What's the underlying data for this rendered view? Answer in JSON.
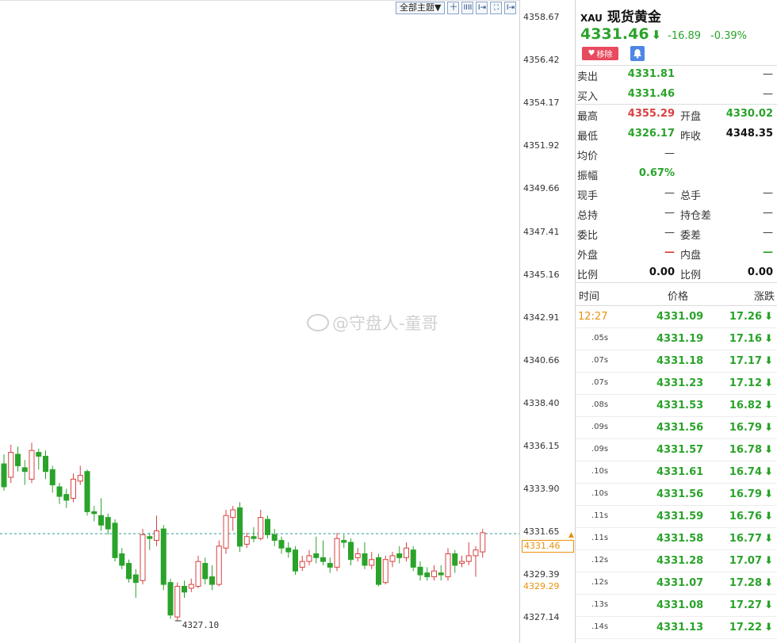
{
  "toolbar": {
    "theme_label": "全部主题▼",
    "buttons": [
      "十",
      "IIII",
      "I⇥",
      "⛶",
      "I⇥"
    ]
  },
  "watermark": "@守盘人-童哥",
  "axis": {
    "ticks": [
      "4358.67",
      "4356.42",
      "4354.17",
      "4351.92",
      "4349.66",
      "4347.41",
      "4345.16",
      "4342.91",
      "4340.66",
      "4338.40",
      "4336.15",
      "4333.90",
      "4331.65",
      "4329.39",
      "4327.14"
    ],
    "current_price_tag": "4331.46",
    "low_price_tag": "4329.29"
  },
  "chart_data": {
    "type": "candlestick",
    "ylim": [
      4327.14,
      4358.67
    ],
    "low_label": "4327.10",
    "reference_line": 4331.65,
    "candles": [
      {
        "o": 4335.3,
        "c": 4334.1,
        "h": 4335.8,
        "l": 4333.9
      },
      {
        "o": 4334.6,
        "c": 4335.9,
        "h": 4336.3,
        "l": 4334.3
      },
      {
        "o": 4335.8,
        "c": 4335.2,
        "h": 4336.2,
        "l": 4334.9
      },
      {
        "o": 4335.1,
        "c": 4334.9,
        "h": 4335.5,
        "l": 4334.2
      },
      {
        "o": 4334.5,
        "c": 4336.0,
        "h": 4336.4,
        "l": 4334.3
      },
      {
        "o": 4335.9,
        "c": 4335.7,
        "h": 4336.1,
        "l": 4335.0
      },
      {
        "o": 4335.7,
        "c": 4334.9,
        "h": 4336.0,
        "l": 4334.5
      },
      {
        "o": 4335.0,
        "c": 4334.2,
        "h": 4335.2,
        "l": 4333.8
      },
      {
        "o": 4334.1,
        "c": 4333.6,
        "h": 4334.3,
        "l": 4333.2
      },
      {
        "o": 4333.7,
        "c": 4333.4,
        "h": 4334.0,
        "l": 4333.0
      },
      {
        "o": 4333.5,
        "c": 4334.5,
        "h": 4334.8,
        "l": 4333.3
      },
      {
        "o": 4334.4,
        "c": 4334.7,
        "h": 4335.2,
        "l": 4334.2
      },
      {
        "o": 4334.9,
        "c": 4332.8,
        "h": 4335.0,
        "l": 4332.6
      },
      {
        "o": 4332.8,
        "c": 4332.7,
        "h": 4333.1,
        "l": 4332.3
      },
      {
        "o": 4332.6,
        "c": 4332.1,
        "h": 4333.5,
        "l": 4331.8
      },
      {
        "o": 4332.5,
        "c": 4331.9,
        "h": 4332.7,
        "l": 4331.6
      },
      {
        "o": 4332.2,
        "c": 4330.4,
        "h": 4332.4,
        "l": 4330.2
      },
      {
        "o": 4330.6,
        "c": 4330.0,
        "h": 4330.9,
        "l": 4329.8
      },
      {
        "o": 4330.1,
        "c": 4329.3,
        "h": 4330.3,
        "l": 4329.1
      },
      {
        "o": 4329.5,
        "c": 4329.1,
        "h": 4329.8,
        "l": 4328.3
      },
      {
        "o": 4329.2,
        "c": 4331.6,
        "h": 4331.9,
        "l": 4329.0
      },
      {
        "o": 4331.5,
        "c": 4331.4,
        "h": 4331.7,
        "l": 4330.8
      },
      {
        "o": 4331.3,
        "c": 4331.8,
        "h": 4332.6,
        "l": 4331.0
      },
      {
        "o": 4331.9,
        "c": 4329.0,
        "h": 4332.1,
        "l": 4328.7
      },
      {
        "o": 4329.1,
        "c": 4327.4,
        "h": 4329.3,
        "l": 4327.2
      },
      {
        "o": 4327.3,
        "c": 4328.9,
        "h": 4329.1,
        "l": 4327.1
      },
      {
        "o": 4328.9,
        "c": 4328.6,
        "h": 4329.2,
        "l": 4328.3
      },
      {
        "o": 4328.8,
        "c": 4329.0,
        "h": 4329.3,
        "l": 4328.6
      },
      {
        "o": 4328.9,
        "c": 4330.2,
        "h": 4330.5,
        "l": 4328.8
      },
      {
        "o": 4330.1,
        "c": 4329.3,
        "h": 4330.4,
        "l": 4329.0
      },
      {
        "o": 4329.4,
        "c": 4329.0,
        "h": 4330.0,
        "l": 4328.7
      },
      {
        "o": 4329.0,
        "c": 4331.0,
        "h": 4331.3,
        "l": 4328.9
      },
      {
        "o": 4330.9,
        "c": 4332.6,
        "h": 4332.9,
        "l": 4330.6
      },
      {
        "o": 4332.5,
        "c": 4332.9,
        "h": 4333.1,
        "l": 4331.8
      },
      {
        "o": 4333.0,
        "c": 4331.0,
        "h": 4333.3,
        "l": 4330.7
      },
      {
        "o": 4331.1,
        "c": 4331.5,
        "h": 4331.7,
        "l": 4330.9
      },
      {
        "o": 4331.5,
        "c": 4331.4,
        "h": 4332.0,
        "l": 4331.2
      },
      {
        "o": 4331.4,
        "c": 4332.5,
        "h": 4332.9,
        "l": 4331.3
      },
      {
        "o": 4332.4,
        "c": 4331.6,
        "h": 4332.6,
        "l": 4331.4
      },
      {
        "o": 4331.6,
        "c": 4331.3,
        "h": 4331.9,
        "l": 4331.0
      },
      {
        "o": 4331.3,
        "c": 4330.9,
        "h": 4331.5,
        "l": 4330.6
      },
      {
        "o": 4330.9,
        "c": 4330.7,
        "h": 4331.2,
        "l": 4330.4
      },
      {
        "o": 4330.8,
        "c": 4329.7,
        "h": 4331.0,
        "l": 4329.5
      },
      {
        "o": 4329.9,
        "c": 4330.2,
        "h": 4330.5,
        "l": 4329.7
      },
      {
        "o": 4330.2,
        "c": 4330.5,
        "h": 4330.8,
        "l": 4330.0
      },
      {
        "o": 4330.6,
        "c": 4330.4,
        "h": 4331.5,
        "l": 4330.1
      },
      {
        "o": 4330.4,
        "c": 4330.2,
        "h": 4331.3,
        "l": 4330.0
      },
      {
        "o": 4330.1,
        "c": 4329.9,
        "h": 4330.4,
        "l": 4329.6
      },
      {
        "o": 4329.9,
        "c": 4331.4,
        "h": 4331.7,
        "l": 4329.7
      },
      {
        "o": 4331.3,
        "c": 4331.2,
        "h": 4331.6,
        "l": 4330.9
      },
      {
        "o": 4331.2,
        "c": 4330.3,
        "h": 4331.4,
        "l": 4330.0
      },
      {
        "o": 4330.4,
        "c": 4330.6,
        "h": 4330.9,
        "l": 4330.2
      },
      {
        "o": 4330.6,
        "c": 4330.0,
        "h": 4331.2,
        "l": 4329.8
      },
      {
        "o": 4330.0,
        "c": 4330.3,
        "h": 4330.7,
        "l": 4329.8
      },
      {
        "o": 4330.4,
        "c": 4329.0,
        "h": 4330.6,
        "l": 4328.9
      },
      {
        "o": 4329.1,
        "c": 4330.3,
        "h": 4330.5,
        "l": 4329.0
      },
      {
        "o": 4330.2,
        "c": 4330.5,
        "h": 4330.7,
        "l": 4329.9
      },
      {
        "o": 4330.6,
        "c": 4330.4,
        "h": 4331.0,
        "l": 4330.1
      },
      {
        "o": 4330.4,
        "c": 4330.9,
        "h": 4331.2,
        "l": 4330.2
      },
      {
        "o": 4330.8,
        "c": 4329.9,
        "h": 4331.0,
        "l": 4329.7
      },
      {
        "o": 4329.9,
        "c": 4329.5,
        "h": 4330.2,
        "l": 4329.2
      },
      {
        "o": 4329.6,
        "c": 4329.4,
        "h": 4329.9,
        "l": 4329.2
      },
      {
        "o": 4329.4,
        "c": 4329.7,
        "h": 4330.0,
        "l": 4329.2
      },
      {
        "o": 4329.6,
        "c": 4329.5,
        "h": 4330.0,
        "l": 4329.2
      },
      {
        "o": 4329.4,
        "c": 4330.6,
        "h": 4330.9,
        "l": 4329.2
      },
      {
        "o": 4330.6,
        "c": 4330.0,
        "h": 4330.8,
        "l": 4329.6
      },
      {
        "o": 4330.1,
        "c": 4330.2,
        "h": 4330.5,
        "l": 4329.9
      },
      {
        "o": 4330.2,
        "c": 4330.5,
        "h": 4331.2,
        "l": 4330.0
      },
      {
        "o": 4330.5,
        "c": 4330.8,
        "h": 4331.0,
        "l": 4329.4
      },
      {
        "o": 4330.7,
        "c": 4331.7,
        "h": 4331.9,
        "l": 4330.4
      }
    ]
  },
  "panel": {
    "symbol_code": "XAU",
    "symbol_name": "现货黄金",
    "price": "4331.46",
    "arrow": "⬇",
    "change": "-16.89",
    "change_pct": "-0.39%",
    "remove_label": "移除",
    "rows": [
      {
        "l1": "卖出",
        "v1": "4331.81",
        "c1": "green",
        "l2": "",
        "v2": "—",
        "c2": "dash"
      },
      {
        "l1": "买入",
        "v1": "4331.46",
        "c1": "green",
        "l2": "",
        "v2": "—",
        "c2": "dash"
      },
      {
        "l1": "最高",
        "v1": "4355.29",
        "c1": "red",
        "l2": "开盘",
        "v2": "4330.02",
        "c2": "green"
      },
      {
        "l1": "最低",
        "v1": "4326.17",
        "c1": "green",
        "l2": "昨收",
        "v2": "4348.35",
        "c2": "black"
      },
      {
        "l1": "均价",
        "v1": "—",
        "c1": "dash",
        "l2": "",
        "v2": "",
        "c2": "dash"
      },
      {
        "l1": "振幅",
        "v1": "0.67%",
        "c1": "green",
        "l2": "",
        "v2": "",
        "c2": "dash"
      },
      {
        "l1": "现手",
        "v1": "—",
        "c1": "dash",
        "l2": "总手",
        "v2": "—",
        "c2": "dash"
      },
      {
        "l1": "总持",
        "v1": "—",
        "c1": "dash",
        "l2": "持仓差",
        "v2": "—",
        "c2": "dash"
      },
      {
        "l1": "委比",
        "v1": "—",
        "c1": "dash",
        "l2": "委差",
        "v2": "—",
        "c2": "dash"
      },
      {
        "l1": "外盘",
        "v1": "—",
        "c1": "red",
        "l2": "内盘",
        "v2": "—",
        "c2": "green"
      },
      {
        "l1": "比例",
        "v1": "0.00",
        "c1": "black",
        "l2": "比例",
        "v2": "0.00",
        "c2": "black"
      }
    ],
    "ticks_header": {
      "time": "时间",
      "price": "价格",
      "change": "涨跌"
    },
    "ticks": [
      {
        "time": "12:27",
        "price": "4331.09",
        "change": "17.26"
      },
      {
        "time": ".05s",
        "price": "4331.19",
        "change": "17.16"
      },
      {
        "time": ".07s",
        "price": "4331.18",
        "change": "17.17"
      },
      {
        "time": ".07s",
        "price": "4331.23",
        "change": "17.12"
      },
      {
        "time": ".08s",
        "price": "4331.53",
        "change": "16.82"
      },
      {
        "time": ".09s",
        "price": "4331.56",
        "change": "16.79"
      },
      {
        "time": ".09s",
        "price": "4331.57",
        "change": "16.78"
      },
      {
        "time": ".10s",
        "price": "4331.61",
        "change": "16.74"
      },
      {
        "time": ".10s",
        "price": "4331.56",
        "change": "16.79"
      },
      {
        "time": ".11s",
        "price": "4331.59",
        "change": "16.76"
      },
      {
        "time": ".11s",
        "price": "4331.58",
        "change": "16.77"
      },
      {
        "time": ".12s",
        "price": "4331.28",
        "change": "17.07"
      },
      {
        "time": ".12s",
        "price": "4331.07",
        "change": "17.28"
      },
      {
        "time": ".13s",
        "price": "4331.08",
        "change": "17.27"
      },
      {
        "time": ".14s",
        "price": "4331.13",
        "change": "17.22"
      }
    ],
    "tick_arrow": "⬇"
  },
  "colors": {
    "up": "#d94040",
    "down": "#2aa32a",
    "ref_line": "#2a9a9a",
    "accent": "#e8920c"
  }
}
